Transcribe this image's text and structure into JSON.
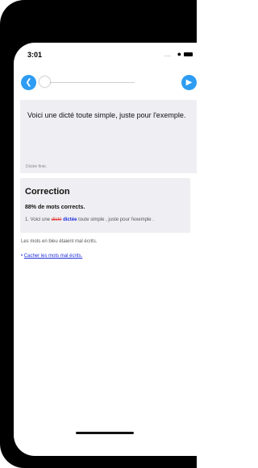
{
  "status_bar": {
    "time": "3:01",
    "signal": "....",
    "wifi_icon": "wifi-icon",
    "battery_icon": "battery-icon"
  },
  "player": {
    "prev_icon": "chevron-left-icon",
    "next_icon": "play-icon",
    "progress": 0.0
  },
  "dictation": {
    "text": "Voici une dicté toute simple, juste pour l'exemple.",
    "status": "Dictée finie."
  },
  "correction": {
    "title": "Correction",
    "score": "88% de mots corrects.",
    "line_prefix": "1.  Voici une",
    "wrong_word": "dicté",
    "right_word": "dictée",
    "line_suffix": "toute simple , juste pour l'exemple ."
  },
  "info": "Les mots en bleu étaient mal écrits.",
  "link": {
    "bullet": "•",
    "label": "Cacher les mots mal écrits."
  },
  "colors": {
    "accent": "#2e9cf2",
    "wrong": "#e23b3b",
    "corrected": "#1a2cd9",
    "panel": "#efeff3"
  }
}
